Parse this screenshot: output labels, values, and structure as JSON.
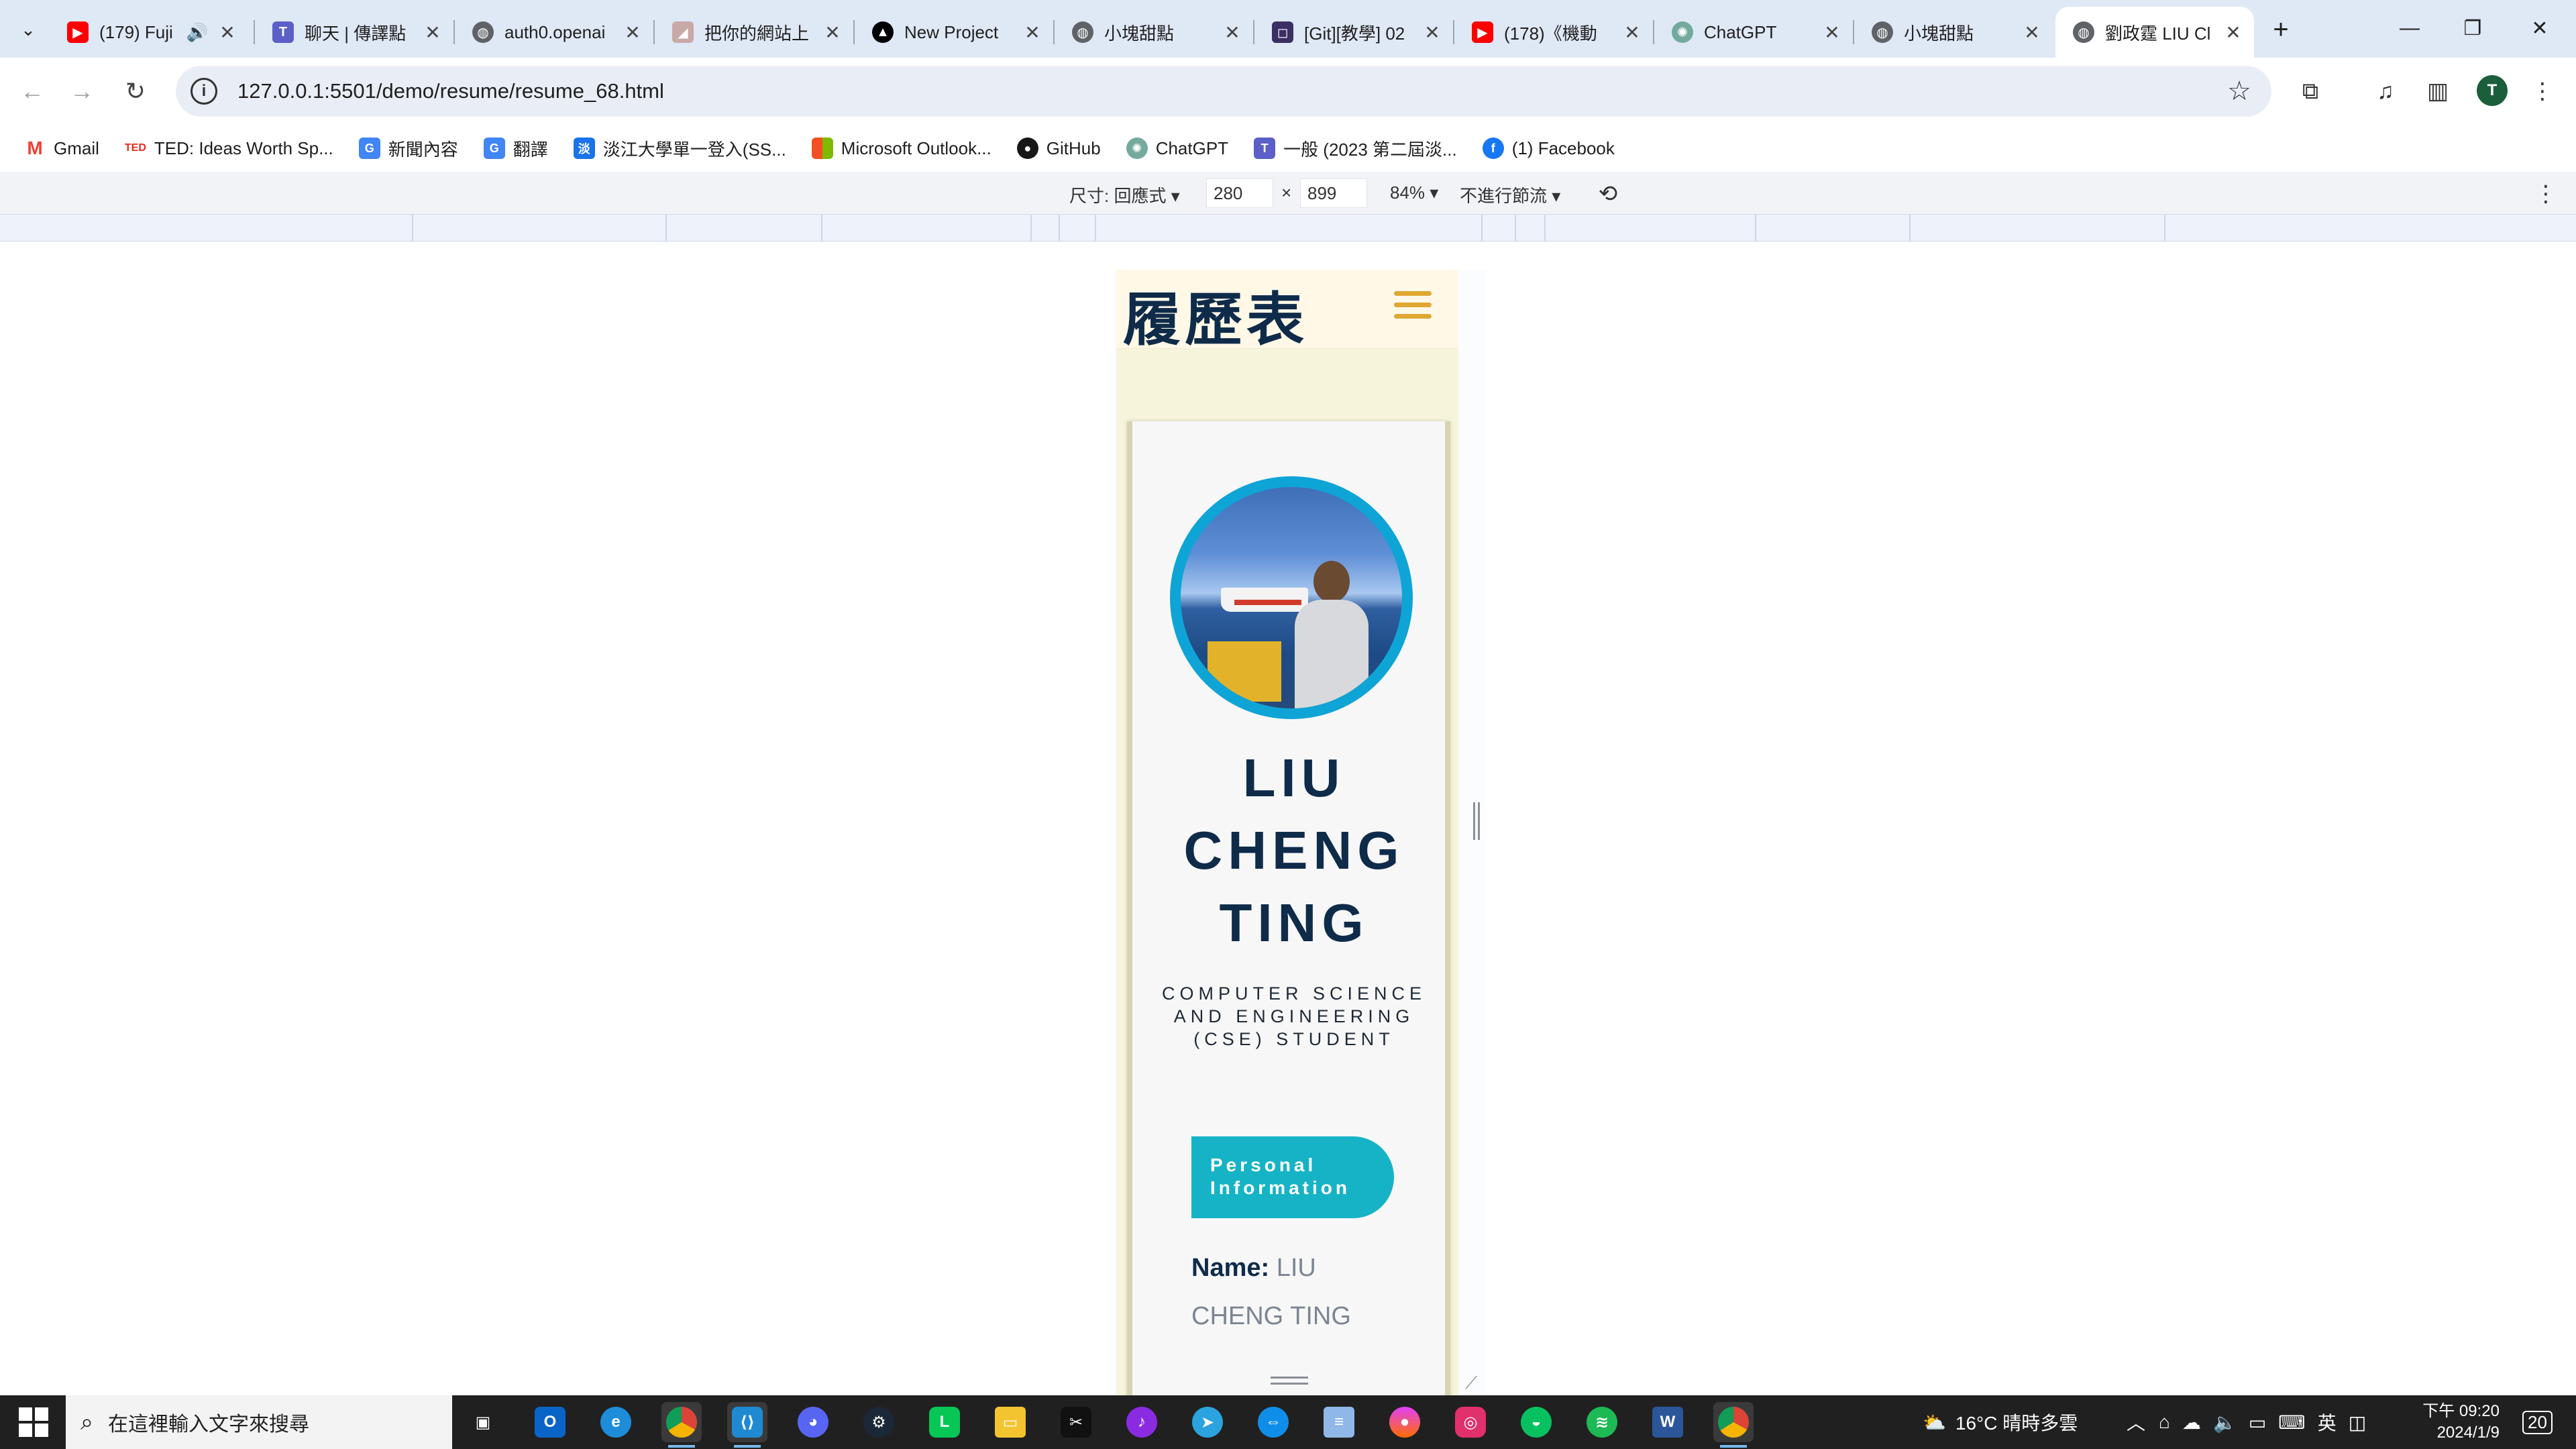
{
  "browser": {
    "tabs": [
      {
        "title": "(179) Fuji",
        "icon": "youtube-icon",
        "color": "#ff0000",
        "audio": true
      },
      {
        "title": "聊天 | 傳譯點",
        "icon": "teams-icon",
        "color": "#5b5fc7"
      },
      {
        "title": "auth0.openai",
        "icon": "globe-icon",
        "color": "#5f6368"
      },
      {
        "title": "把你的網站上",
        "icon": "triangle-icon",
        "color": "#c9a8a8"
      },
      {
        "title": "New Project",
        "icon": "vercel-icon",
        "color": "#000000"
      },
      {
        "title": "小塊甜點",
        "icon": "globe-icon",
        "color": "#5f6368"
      },
      {
        "title": "[Git][教學] 02",
        "icon": "square-icon",
        "color": "#3b2f63"
      },
      {
        "title": "(178)《機動",
        "icon": "youtube-icon",
        "color": "#ff0000"
      },
      {
        "title": "ChatGPT",
        "icon": "chatgpt-icon",
        "color": "#74aa9c"
      },
      {
        "title": "小塊甜點",
        "icon": "globe-icon",
        "color": "#5f6368"
      },
      {
        "title": "劉政霆 LIU Cl",
        "icon": "globe-icon",
        "color": "#5f6368",
        "active": true
      }
    ],
    "url": "127.0.0.1:5501/demo/resume/resume_68.html",
    "bookmarks": [
      {
        "label": "Gmail",
        "icon": "gmail-icon",
        "color": "#ea4335",
        "glyph": "M"
      },
      {
        "label": "TED: Ideas Worth Sp...",
        "icon": "ted-icon",
        "color": "#e62b1e",
        "glyph": "TED"
      },
      {
        "label": "新聞內容",
        "icon": "news-icon",
        "color": "#4285f4",
        "glyph": "G"
      },
      {
        "label": "翻譯",
        "icon": "translate-icon",
        "color": "#4285f4",
        "glyph": "G"
      },
      {
        "label": "淡江大學單一登入(SS...",
        "icon": "university-icon",
        "color": "#1a73e8",
        "glyph": "淡"
      },
      {
        "label": "Microsoft Outlook...",
        "icon": "microsoft-icon",
        "color": "#f25022",
        "glyph": "■"
      },
      {
        "label": "GitHub",
        "icon": "github-icon",
        "color": "#181717",
        "glyph": "●"
      },
      {
        "label": "ChatGPT",
        "icon": "chatgpt-icon",
        "color": "#74aa9c",
        "glyph": "✺"
      },
      {
        "label": "一般 (2023 第二屆淡...",
        "icon": "teams-icon",
        "color": "#5b5fc7",
        "glyph": "T"
      },
      {
        "label": "(1) Facebook",
        "icon": "facebook-icon",
        "color": "#1877f2",
        "glyph": "f"
      }
    ]
  },
  "device_toolbar": {
    "dimensions_label": "尺寸: 回應式 ▾",
    "width": "280",
    "times": "×",
    "height": "899",
    "zoom": "84% ▾",
    "throttle": "不進行節流 ▾"
  },
  "site": {
    "header_title": "履歷表",
    "name_lines": [
      "LIU",
      "CHENG",
      "TING"
    ],
    "subtitle": "COMPUTER SCIENCE AND ENGINEERING (CSE) STUDENT",
    "info_button": "Personal Information",
    "info_rows": [
      {
        "label": "Name:",
        "value": "LIU CHENG TING"
      }
    ],
    "accent_color": "#16b3c6",
    "hamburger_color": "#e0a832"
  },
  "taskbar": {
    "search_placeholder": "在這裡輸入文字來搜尋",
    "weather": "16°C  晴時多雲",
    "ime": "英",
    "time": "下午 09:20",
    "date": "2024/1/9",
    "notifications": "20"
  }
}
